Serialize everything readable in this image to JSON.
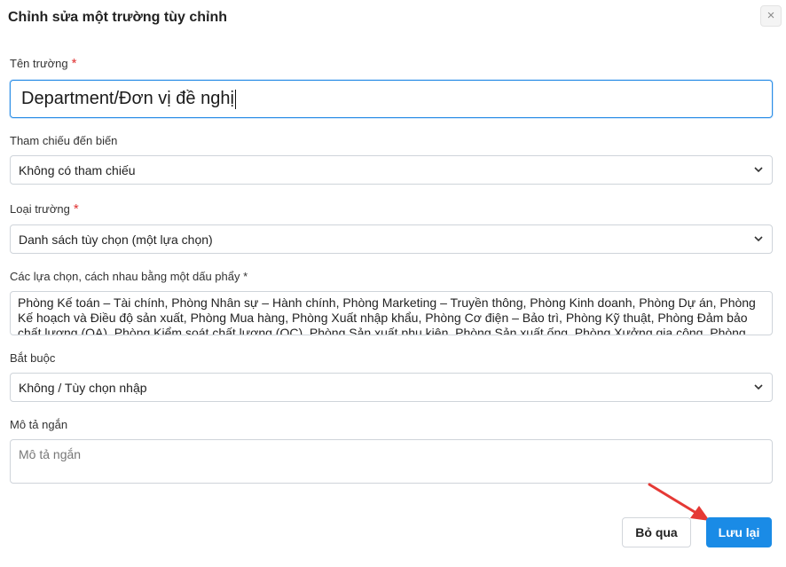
{
  "dialog": {
    "title": "Chỉnh sửa một trường tùy chỉnh",
    "close_label": "×"
  },
  "form": {
    "name": {
      "label": "Tên trường",
      "required_mark": "*",
      "value": "Department/Đơn vị đề nghị"
    },
    "reference": {
      "label": "Tham chiếu đến biến",
      "value": "Không có tham chiếu"
    },
    "type": {
      "label": "Loại trường",
      "required_mark": "*",
      "value": "Danh sách tùy chọn (một lựa chọn)"
    },
    "options": {
      "label": "Các lựa chọn, cách nhau bằng một dấu phẩy *",
      "value": "Phòng Kế toán – Tài chính, Phòng Nhân sự – Hành chính, Phòng Marketing – Truyền thông, Phòng Kinh doanh, Phòng Dự án, Phòng Kế hoạch và Điều độ sản xuất, Phòng Mua hàng, Phòng Xuất nhập khẩu, Phòng Cơ điện – Bảo trì, Phòng Kỹ thuật, Phòng Đảm bảo chất lượng (QA), Phòng Kiểm soát chất lượng (QC), Phòng Sản xuất phụ kiện, Phòng Sản xuất ống, Phòng Xưởng gia công, Phòng Thí nghiệm"
    },
    "required": {
      "label": "Bắt buộc",
      "value": "Không / Tùy chọn nhập"
    },
    "description": {
      "label": "Mô tả ngắn",
      "placeholder": "Mô tả ngắn",
      "value": ""
    }
  },
  "actions": {
    "cancel_label": "Bỏ qua",
    "save_label": "Lưu lại"
  },
  "colors": {
    "primary": "#1a8be6",
    "required": "#e03131",
    "annotation_arrow": "#e53935"
  },
  "icons": [
    "close-icon",
    "chevron-down-icon",
    "arrow-annotation-icon"
  ]
}
